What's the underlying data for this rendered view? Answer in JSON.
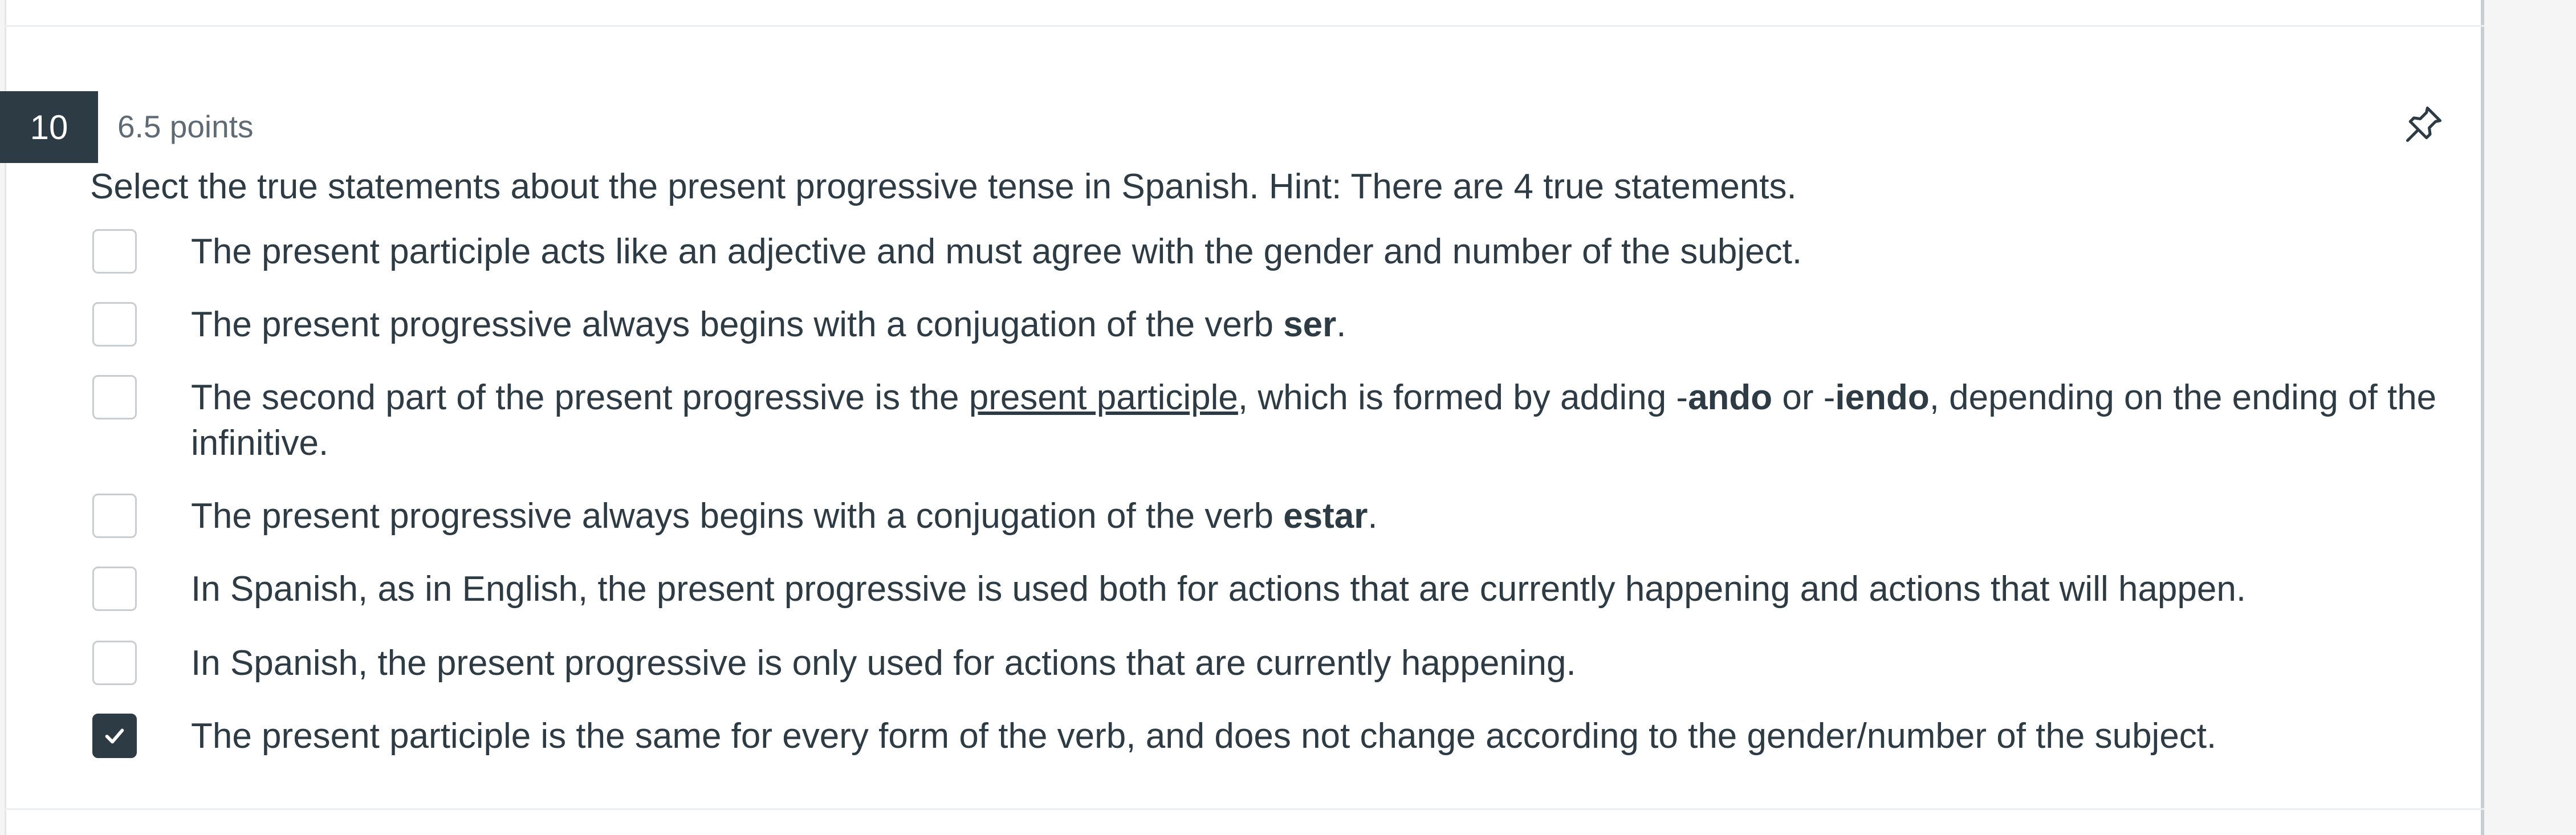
{
  "question": {
    "number": "10",
    "points": "6.5 points",
    "prompt": "Select the true statements about the present progressive tense in Spanish. Hint: There are 4 true statements."
  },
  "options": [
    {
      "text": "The present participle acts like an adjective and must agree with the gender and number of the subject.",
      "checked": false
    },
    {
      "text_before": "The present progressive always begins with a conjugation of the verb ",
      "bold": "ser",
      "text_after": ".",
      "checked": false
    },
    {
      "text_a": "The second part of the present progressive is the ",
      "underline": "present participle",
      "text_b": ", which is formed by adding -",
      "bold_1": "ando",
      "text_c": " or -",
      "bold_2": "iendo",
      "text_d": ", depending on the ending of the infinitive.",
      "checked": false
    },
    {
      "text_before": "The present progressive always begins with a conjugation of the verb ",
      "bold": "estar",
      "text_after": ".",
      "checked": false
    },
    {
      "text": "In Spanish, as in English, the present progressive is used both for actions that are currently happening and actions that will happen.",
      "checked": false
    },
    {
      "text": "In Spanish, the present progressive is only used for actions that are currently happening.",
      "checked": false
    },
    {
      "text": "The present participle is the same for every form of the verb, and does not change according to the gender/number of the subject.",
      "checked": true
    }
  ],
  "icons": {
    "pin": "pin-icon",
    "check": "checkmark-icon"
  },
  "colors": {
    "dark": "#2d3b45",
    "border": "#c7cdd1",
    "muted": "#5e6b75"
  }
}
